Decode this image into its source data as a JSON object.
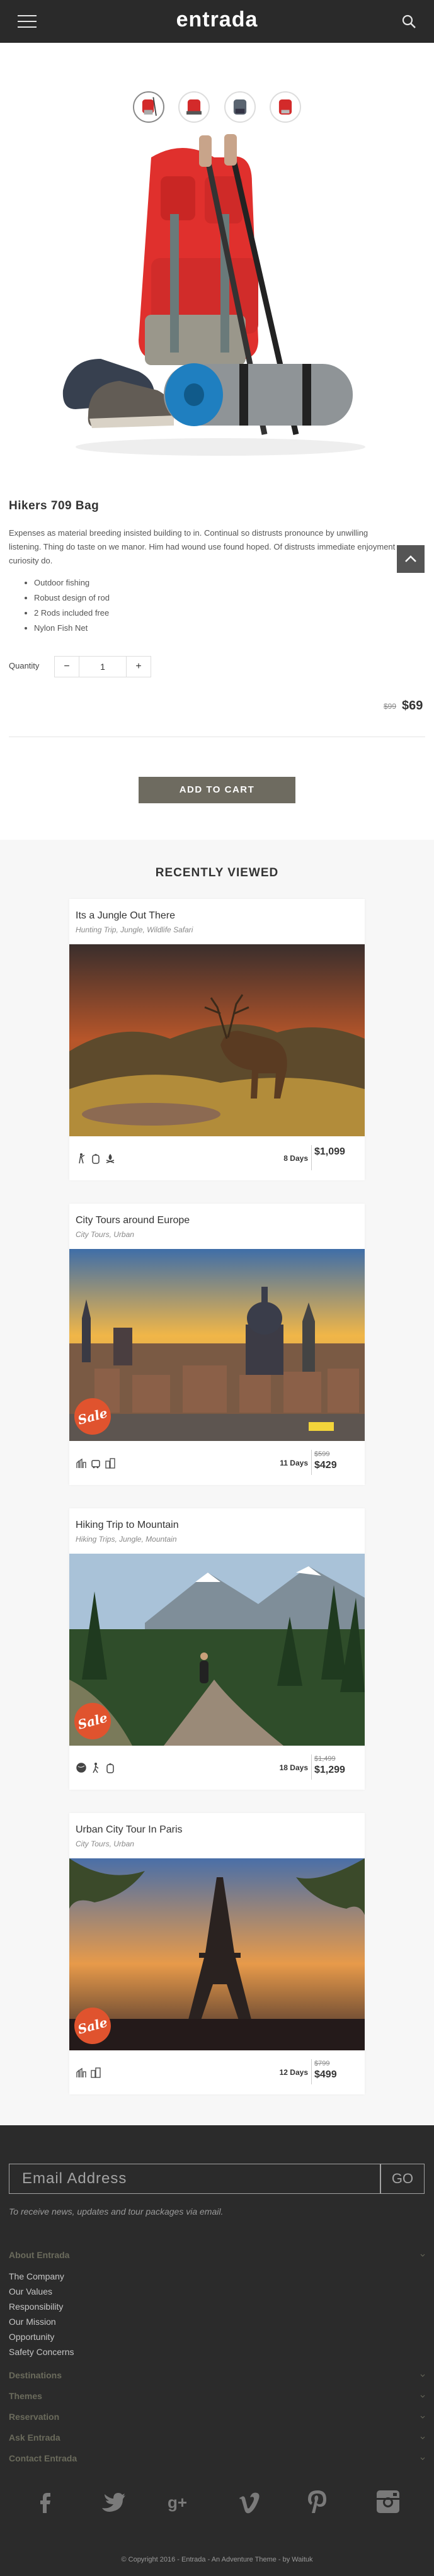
{
  "header": {
    "logo": "entrada",
    "menu_icon": "hamburger-menu-icon",
    "search_icon": "search-icon"
  },
  "product": {
    "thumbnails": [
      "red-backpack-thumb",
      "red-backpack-thumb",
      "gray-backpack-thumb",
      "red-backpack-thumb"
    ],
    "title": "Hikers 709 Bag",
    "description": "Expenses as material breeding insisted building to in. Continual so distrusts pronounce by unwilling listening. Thing do taste on we manor. Him had wound use found hoped. Of distrusts immediate enjoyment curiosity do.",
    "features": [
      "Outdoor fishing",
      "Robust design of rod",
      "2 Rods included free",
      "Nylon Fish Net"
    ],
    "quantity_label": "Quantity",
    "quantity": "1",
    "minus": "−",
    "plus": "+",
    "price_old": "$99",
    "price_new": "$69",
    "add_to_cart": "ADD TO CART"
  },
  "recently_viewed": {
    "title": "RECENTLY VIEWED",
    "cards": [
      {
        "title": "Its a Jungle Out There",
        "sub": "Hunting Trip, Jungle, Wildlife Safari",
        "days": "8 Days",
        "price_old": "",
        "price": "$1,099",
        "sale": false,
        "image": "deer-landscape",
        "icons": [
          "hunter-icon",
          "backpack-icon",
          "campfire-icon"
        ]
      },
      {
        "title": "City Tours around Europe",
        "sub": "City Tours, Urban",
        "days": "11 Days",
        "price_old": "$599",
        "price": "$429",
        "sale": true,
        "image": "city-europe",
        "icons": [
          "city-icon",
          "bus-icon",
          "buildings-icon"
        ]
      },
      {
        "title": "Hiking Trip to Mountain",
        "sub": "Hiking Trips, Jungle, Mountain",
        "days": "18 Days",
        "price_old": "$1,499",
        "price": "$1,299",
        "sale": true,
        "image": "mountain-hike",
        "icons": [
          "globe-icon",
          "hiker-icon",
          "backpack-icon"
        ]
      },
      {
        "title": "Urban City Tour In Paris",
        "sub": "City Tours, Urban",
        "days": "12 Days",
        "price_old": "$799",
        "price": "$499",
        "sale": true,
        "image": "paris-eiffel",
        "icons": [
          "city-icon",
          "buildings-icon"
        ]
      }
    ],
    "sale_label": "Sale"
  },
  "footer": {
    "email_placeholder": "Email Address",
    "go": "GO",
    "news_note": "To receive news, updates and tour packages via email.",
    "about_heading": "About Entrada",
    "about_links": [
      "The Company",
      "Our Values",
      "Responsibility",
      "Our Mission",
      "Opportunity",
      "Safety Concerns"
    ],
    "sections": [
      "Destinations",
      "Themes",
      "Reservation",
      "Ask Entrada",
      "Contact Entrada"
    ],
    "social": [
      "facebook-icon",
      "twitter-icon",
      "google-plus-icon",
      "vimeo-icon",
      "pinterest-icon",
      "instagram-icon"
    ],
    "copyright": "© Copyright 2016 - Entrada - An Adventure Theme - by Waituk"
  },
  "colors": {
    "header_bg": "#2a2a2a",
    "button": "#6e6b60",
    "sale": "#e0532e",
    "footer_bg": "#2b2b2b"
  }
}
